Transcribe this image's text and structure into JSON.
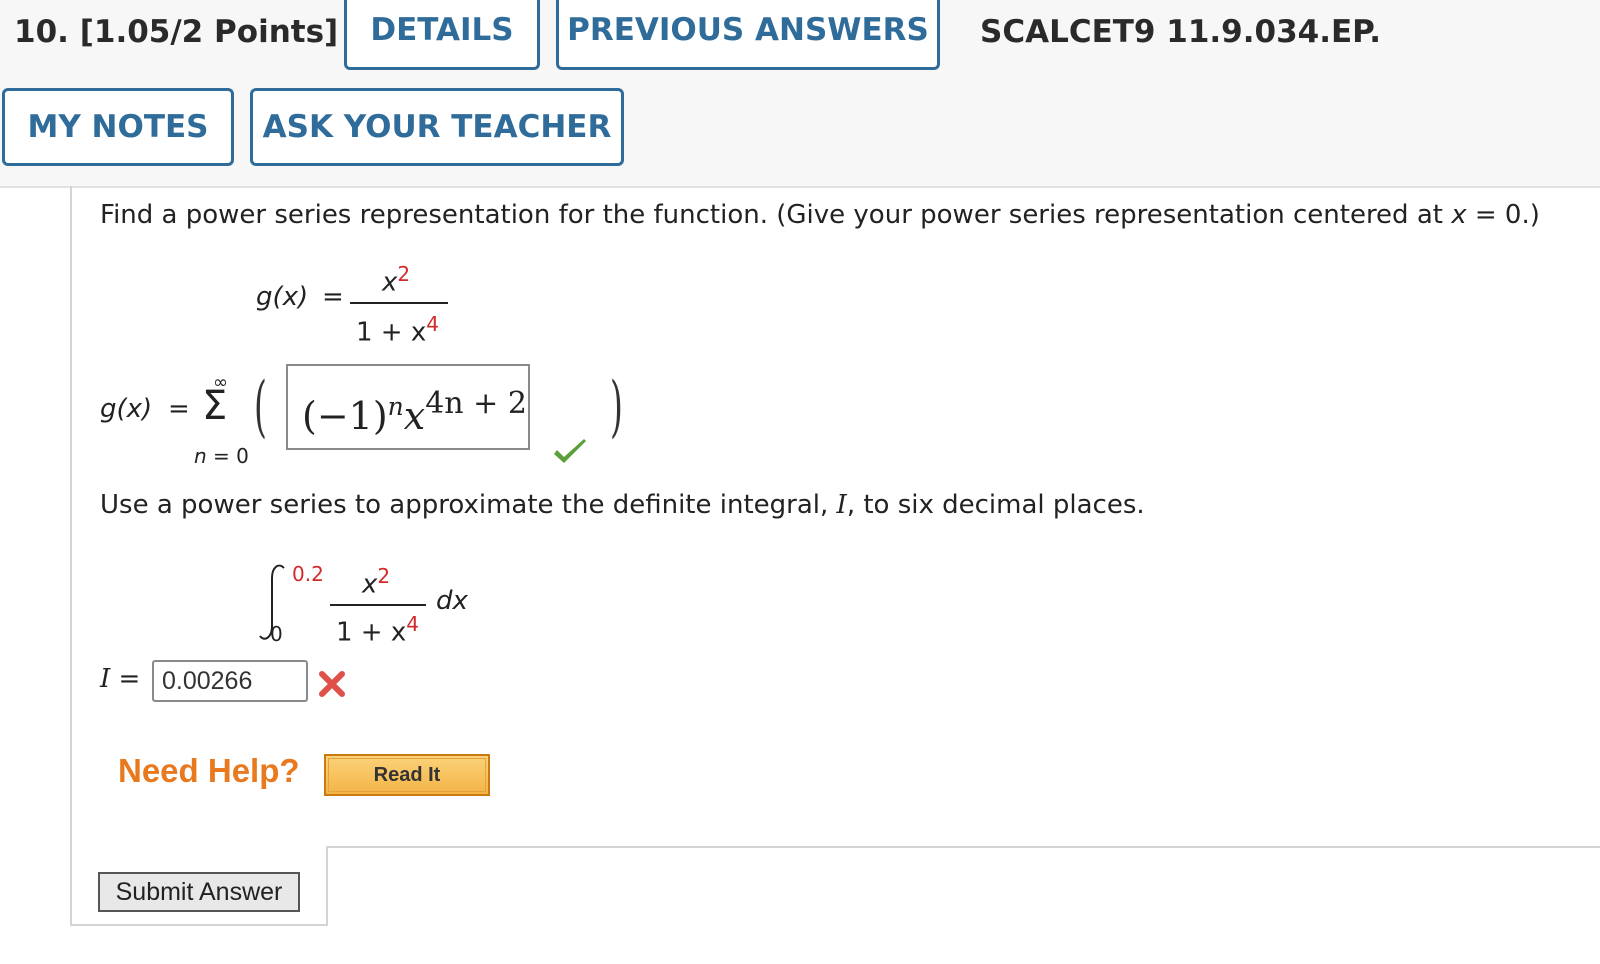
{
  "header": {
    "question_label": "10.  [1.05/2 Points]",
    "details_label": "DETAILS",
    "previous_answers_label": "PREVIOUS ANSWERS",
    "question_id": "SCALCET9 11.9.034.EP.",
    "my_notes_label": "MY NOTES",
    "ask_teacher_label": "ASK YOUR TEACHER"
  },
  "problem": {
    "prompt_1_main": "Find a power series representation for the function. (Give your power series representation centered at ",
    "prompt_1_var": "x",
    "prompt_1_end": " = 0.)",
    "function_lhs": "g(x)",
    "equals": "=",
    "numerator_base": "x",
    "numerator_exp": "2",
    "denominator_base": "1 + x",
    "denominator_exp": "4",
    "series_lhs": "g(x)",
    "sum_upper": "∞",
    "sum_symbol": "Σ",
    "sum_lower": "n = 0",
    "answer_base": "(−1)",
    "answer_n": "n",
    "answer_x": "x",
    "answer_exp": "4n + 2",
    "prompt_2_main": "Use a power series to approximate the definite integral, ",
    "prompt_2_var": "I",
    "prompt_2_end": ", to six decimal places.",
    "integral_upper": "0.2",
    "integral_lower": "0",
    "integrand_num_base": "x",
    "integrand_num_exp": "2",
    "integrand_den_base": "1 + x",
    "integrand_den_exp": "4",
    "differential": "dx",
    "i_label": "I",
    "i_value": "0.00266"
  },
  "help": {
    "need_help": "Need Help?",
    "read_it": "Read It"
  },
  "submit_label": "Submit Answer",
  "colors": {
    "accent": "#2f6c9a",
    "exponent_red": "#d02a2a",
    "correct": "#5aa03a",
    "incorrect": "#e0504a",
    "help_orange": "#e8791e"
  }
}
